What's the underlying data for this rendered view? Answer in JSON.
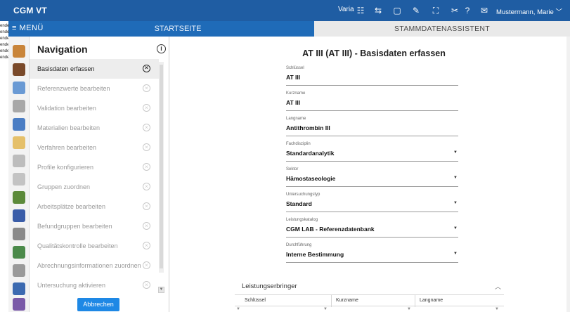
{
  "app": {
    "title": "CGM VT"
  },
  "topbar": {
    "varia_label": "Varia",
    "icons": [
      "grid-icon",
      "transfer-icon",
      "note-icon",
      "edit-icon",
      "chart-icon",
      "scissors-icon",
      "help-icon",
      "mail-icon"
    ],
    "icon_glyphs": [
      "☷",
      "⇆",
      "▢",
      "✎",
      "⛶",
      "✂",
      "?",
      "✉"
    ],
    "user": "Mustermann, Marie",
    "user_chevron": "﹀"
  },
  "nav_bar": {
    "menu_label": "≡  MENÜ",
    "tabs": [
      {
        "label": "STARTSEITE"
      },
      {
        "label": "STAMMDATENASSISTENT"
      }
    ]
  },
  "background_fragment": [
    "ende",
    "ende",
    "ende",
    "ende",
    "ende",
    "ende"
  ],
  "navigation": {
    "title": "Navigation",
    "info_glyph": "i",
    "items": [
      {
        "label": "Basisdaten erfassen",
        "active": true
      },
      {
        "label": "Referenzwerte bearbeiten",
        "active": false
      },
      {
        "label": "Validation bearbeiten",
        "active": false
      },
      {
        "label": "Materialien bearbeiten",
        "active": false
      },
      {
        "label": "Verfahren bearbeiten",
        "active": false
      },
      {
        "label": "Profile konfigurieren",
        "active": false
      },
      {
        "label": "Gruppen zuordnen",
        "active": false
      },
      {
        "label": "Arbeitsplätze bearbeiten",
        "active": false
      },
      {
        "label": "Befundgruppen bearbeiten",
        "active": false
      },
      {
        "label": "Qualitätskontrolle bearbeiten",
        "active": false
      },
      {
        "label": "Abrechnungsinformationen zuordnen",
        "active": false
      },
      {
        "label": "Untersuchung aktivieren",
        "active": false
      }
    ],
    "close_glyph": "×",
    "cancel_label": "Abbrechen"
  },
  "form": {
    "title": "AT III (AT III) - Basisdaten erfassen",
    "fields": [
      {
        "label": "Schlüssel",
        "value": "AT III",
        "dropdown": false
      },
      {
        "label": "Kurzname",
        "value": "AT III",
        "dropdown": false
      },
      {
        "label": "Langname",
        "value": "Antithrombin III",
        "dropdown": false
      },
      {
        "label": "Fachdisziplin",
        "value": "Standardanalytik",
        "dropdown": true
      },
      {
        "label": "Sektor",
        "value": "Hämostaseologie",
        "dropdown": true
      },
      {
        "label": "Untersuchungstyp",
        "value": "Standard",
        "dropdown": true
      },
      {
        "label": "Leistungskatalog",
        "value": "CGM LAB - Referenzdatenbank",
        "dropdown": true
      },
      {
        "label": "Durchführung",
        "value": "Interne Bestimmung",
        "dropdown": true
      }
    ],
    "caret_glyph": "▼"
  },
  "leistungserbringer": {
    "title": "Leistungserbringer",
    "collapse_glyph": "︿",
    "columns": [
      "Schlüssel",
      "Kurzname",
      "Langname"
    ]
  },
  "colors": {
    "topbar": "#1f5da3",
    "navbar": "#1f6bb8",
    "accent_button": "#1e88e5",
    "active_tab": "#e9e9e9"
  }
}
